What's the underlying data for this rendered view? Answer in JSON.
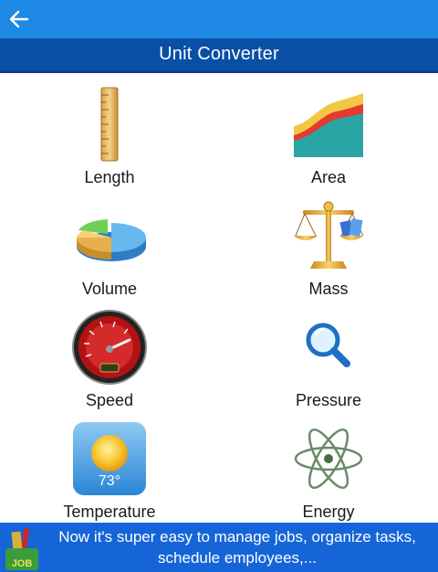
{
  "header": {
    "back_icon": "arrow-left-icon",
    "title": "Unit Converter"
  },
  "colors": {
    "topbar": "#1e88e5",
    "titlebar": "#0a4fa6",
    "ad_banner": "#1565d8"
  },
  "categories": [
    {
      "label": "Length",
      "icon": "ruler-icon"
    },
    {
      "label": "Area",
      "icon": "area-chart-icon"
    },
    {
      "label": "Volume",
      "icon": "pie-chart-icon"
    },
    {
      "label": "Mass",
      "icon": "balance-scale-icon"
    },
    {
      "label": "Speed",
      "icon": "speedometer-icon"
    },
    {
      "label": "Pressure",
      "icon": "magnifier-icon"
    },
    {
      "label": "Temperature",
      "icon": "weather-icon",
      "temp_text": "73°"
    },
    {
      "label": "Energy",
      "icon": "atom-icon"
    }
  ],
  "ad": {
    "logo_icon": "jobs-app-icon",
    "logo_text": "JOB",
    "line1": "Now it's super easy to manage jobs, organize tasks,",
    "line2": "schedule employees,..."
  }
}
